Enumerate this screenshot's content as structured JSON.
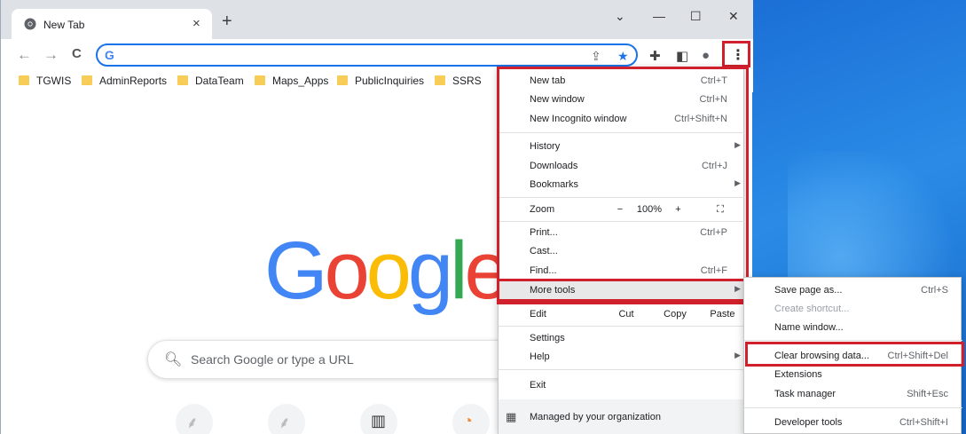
{
  "browser": {
    "tab_title": "New Tab",
    "tab_close": "×",
    "new_tab": "+",
    "window_controls": {
      "minimize": "—",
      "maximize": "☐",
      "close": "✕",
      "chevron": "⌄"
    }
  },
  "toolbar": {
    "back": "←",
    "forward": "→",
    "reload": "C",
    "omnibox_value": "",
    "omnibox_g": "G",
    "share_icon": "⇪",
    "star_icon": "★",
    "extensions_icon": "✚",
    "sidepanel_icon": "◧",
    "profile_icon": "●",
    "menu_icon": "⋮"
  },
  "bookmarks": [
    "TGWIS",
    "AdminReports",
    "DataTeam",
    "Maps_Apps",
    "PublicInquiries",
    "SSRS"
  ],
  "content": {
    "logo": [
      "G",
      "o",
      "o",
      "g",
      "l",
      "e"
    ],
    "search_placeholder": "Search Google or type a URL"
  },
  "menu": {
    "new_tab": {
      "label": "New tab",
      "shortcut": "Ctrl+T"
    },
    "new_window": {
      "label": "New window",
      "shortcut": "Ctrl+N"
    },
    "incognito": {
      "label": "New Incognito window",
      "shortcut": "Ctrl+Shift+N"
    },
    "history": {
      "label": "History"
    },
    "downloads": {
      "label": "Downloads",
      "shortcut": "Ctrl+J"
    },
    "bookmarks": {
      "label": "Bookmarks"
    },
    "zoom": {
      "label": "Zoom",
      "minus": "−",
      "level": "100%",
      "plus": "+",
      "fullscreen": "⛶"
    },
    "print": {
      "label": "Print...",
      "shortcut": "Ctrl+P"
    },
    "cast": {
      "label": "Cast..."
    },
    "find": {
      "label": "Find...",
      "shortcut": "Ctrl+F"
    },
    "more_tools": {
      "label": "More tools"
    },
    "edit": {
      "label": "Edit",
      "cut": "Cut",
      "copy": "Copy",
      "paste": "Paste"
    },
    "settings": {
      "label": "Settings"
    },
    "help": {
      "label": "Help"
    },
    "exit": {
      "label": "Exit"
    },
    "managed": {
      "label": "Managed by your organization"
    }
  },
  "submenu": {
    "save_page": {
      "label": "Save page as...",
      "shortcut": "Ctrl+S"
    },
    "create_shortcut": {
      "label": "Create shortcut..."
    },
    "name_window": {
      "label": "Name window..."
    },
    "clear_browsing": {
      "label": "Clear browsing data...",
      "shortcut": "Ctrl+Shift+Del"
    },
    "extensions": {
      "label": "Extensions"
    },
    "task_manager": {
      "label": "Task manager",
      "shortcut": "Shift+Esc"
    },
    "developer_tools": {
      "label": "Developer tools",
      "shortcut": "Ctrl+Shift+I"
    }
  },
  "colors": {
    "highlight": "#d0202c",
    "google_blue": "#4285f4",
    "google_red": "#ea4335",
    "google_yellow": "#fbbc05",
    "google_green": "#34a853",
    "desktop": "#1b6fd6"
  }
}
